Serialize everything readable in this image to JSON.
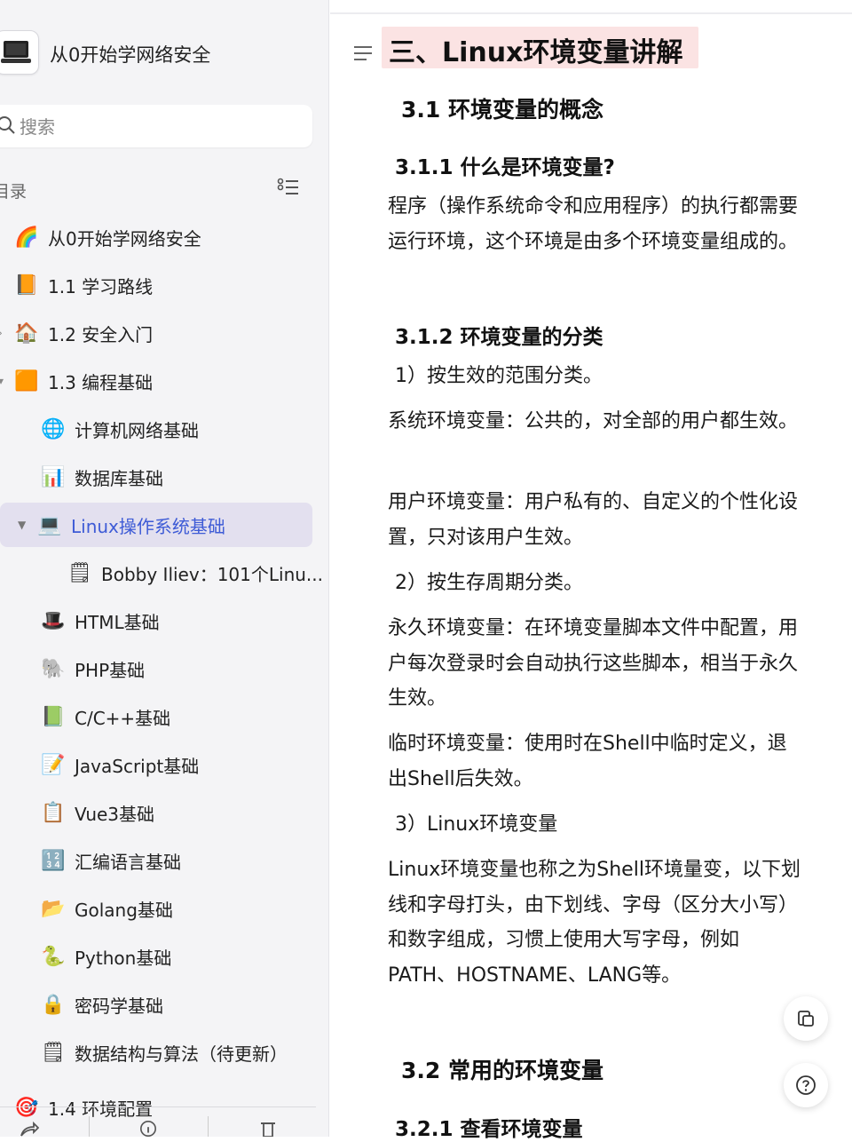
{
  "app": {
    "title": "从0开始学网络安全"
  },
  "search": {
    "placeholder": "搜索"
  },
  "toc": {
    "title": "目录"
  },
  "nav": [
    {
      "label": "从0开始学网络安全",
      "icon": "rainbow-icon"
    },
    {
      "label": "1.1 学习路线",
      "icon": "orange-book-icon"
    },
    {
      "label": "1.2 安全入门",
      "icon": "purple-home-icon"
    },
    {
      "label": "1.3 编程基础",
      "icon": "orange-folder-icon"
    },
    {
      "label": "计算机网络基础",
      "icon": "globe-icon"
    },
    {
      "label": "数据库基础",
      "icon": "bar-chart-icon"
    },
    {
      "label": "Linux操作系统基础",
      "icon": "laptop-icon"
    },
    {
      "label": "Bobby Iliev：101个Linu...",
      "icon": "document-icon"
    },
    {
      "label": "HTML基础",
      "icon": "top-hat-icon"
    },
    {
      "label": "PHP基础",
      "icon": "elephant-icon"
    },
    {
      "label": "C/C++基础",
      "icon": "green-book-icon"
    },
    {
      "label": "JavaScript基础",
      "icon": "memo-icon"
    },
    {
      "label": "Vue3基础",
      "icon": "clipboard-icon"
    },
    {
      "label": "汇编语言基础",
      "icon": "blue-grid-icon"
    },
    {
      "label": "Golang基础",
      "icon": "folder-icon"
    },
    {
      "label": "Python基础",
      "icon": "snake-icon"
    },
    {
      "label": "密码学基础",
      "icon": "lock-icon"
    },
    {
      "label": "数据结构与算法（待更新）",
      "icon": "document-icon"
    },
    {
      "label": "1.4 环境配置",
      "icon": "target-icon"
    }
  ],
  "article": {
    "h1": "三、Linux环境变量讲解",
    "sec_3_1": "3.1 环境变量的概念",
    "sec_3_1_1": "3.1.1 什么是环境变量?",
    "p1": "程序（操作系统命令和应用程序）的执行都需要运行环境，这个环境是由多个环境变量组成的。",
    "sec_3_1_2": "3.1.2 环境变量的分类",
    "p2": "1）按生效的范围分类。",
    "p3": "系统环境变量：公共的，对全部的用户都生效。",
    "p4": "用户环境变量：用户私有的、自定义的个性化设置，只对该用户生效。",
    "p5": "2）按生存周期分类。",
    "p6": "永久环境变量：在环境变量脚本文件中配置，用户每次登录时会自动执行这些脚本，相当于永久生效。",
    "p7": "临时环境变量：使用时在Shell中临时定义，退出Shell后失效。",
    "p8": "3）Linux环境变量",
    "p9": "Linux环境变量也称之为Shell环境量变，以下划线和字母打头，由下划线、字母（区分大小写）和数字组成，习惯上使用大写字母，例如PATH、HOSTNAME、LANG等。",
    "sec_3_2": "3.2 常用的环境变量",
    "sec_3_2_1": "3.2.1 查看环境变量"
  },
  "colors": {
    "active_bg": "#e3e0ef",
    "active_text": "#3e5bd6",
    "heading_highlight": "#fbe3e3"
  }
}
